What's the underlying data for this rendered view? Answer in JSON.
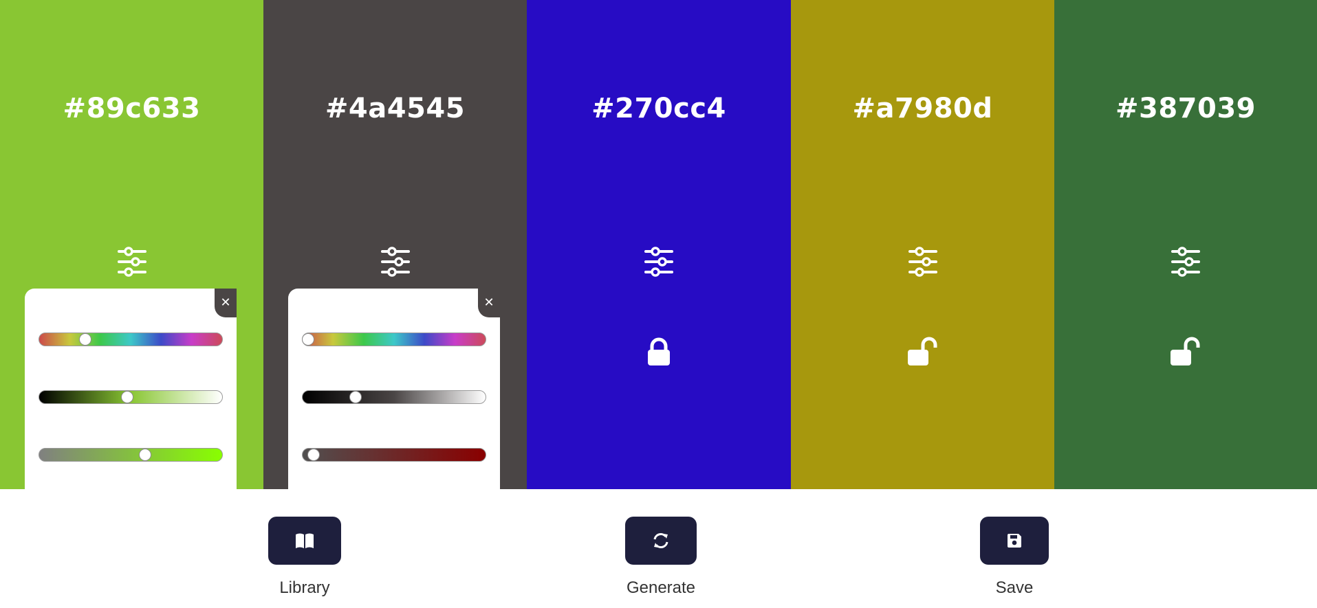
{
  "palette": {
    "columns": [
      {
        "hex": "#89c633",
        "color": "#89c633",
        "lock_state": "unlocked",
        "adjust_icon": "sliders-icon",
        "panel_open": true,
        "sliders": [
          {
            "name": "hue",
            "value": 0.25,
            "track": "hue"
          },
          {
            "name": "brightness",
            "value": 0.48,
            "track": "linear-gradient(to right, #000000, #89c633, #ffffff)"
          },
          {
            "name": "saturation",
            "value": 0.58,
            "track": "linear-gradient(to right, #808080, #89ff00)"
          }
        ]
      },
      {
        "hex": "#4a4545",
        "color": "#4a4545",
        "lock_state": "unlocked",
        "adjust_icon": "sliders-icon",
        "panel_open": true,
        "sliders": [
          {
            "name": "hue",
            "value": 0.03,
            "track": "hue"
          },
          {
            "name": "brightness",
            "value": 0.29,
            "track": "linear-gradient(to right, #000000, #4a4545, #ffffff)"
          },
          {
            "name": "saturation",
            "value": 0.06,
            "track": "linear-gradient(to right, #505050, #8a0000)"
          }
        ]
      },
      {
        "hex": "#270cc4",
        "color": "#270cc4",
        "lock_state": "locked",
        "adjust_icon": "sliders-icon",
        "panel_open": false
      },
      {
        "hex": "#a7980d",
        "color": "#a7980d",
        "lock_state": "unlocked",
        "adjust_icon": "sliders-icon",
        "panel_open": false
      },
      {
        "hex": "#387039",
        "color": "#387039",
        "lock_state": "unlocked",
        "adjust_icon": "sliders-icon",
        "panel_open": false
      }
    ],
    "close_glyph": "✕",
    "close_button_color": "#4a4545"
  },
  "toolbar": {
    "button_color": "#1e1f3d",
    "library": {
      "label": "Library",
      "icon": "book-icon"
    },
    "generate": {
      "label": "Generate",
      "icon": "refresh-icon"
    },
    "save": {
      "label": "Save",
      "icon": "save-icon"
    }
  }
}
